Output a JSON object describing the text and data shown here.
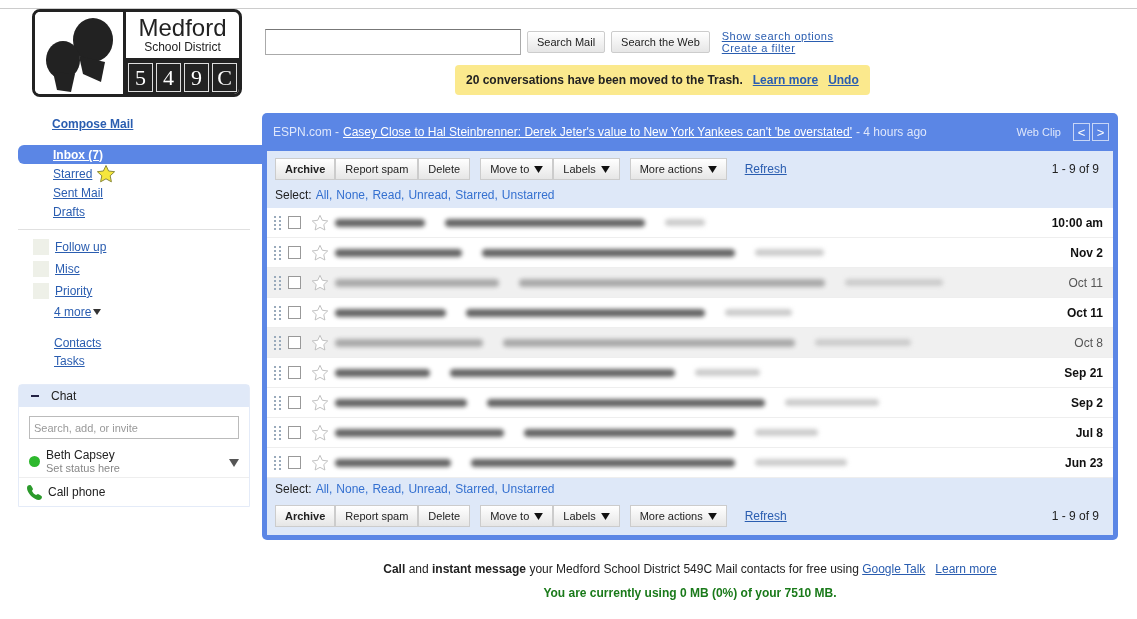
{
  "logo": {
    "name": "Medford",
    "subtitle": "School District",
    "code": [
      "5",
      "4",
      "9",
      "C"
    ]
  },
  "search": {
    "buttons": [
      "Search Mail",
      "Search the Web"
    ],
    "links": [
      "Show search options",
      "Create a filter"
    ]
  },
  "notice": {
    "message": "20 conversations have been moved to the Trash.",
    "links": [
      "Learn more",
      "Undo"
    ]
  },
  "sidebar": {
    "compose": "Compose Mail",
    "folders": [
      {
        "label": "Inbox (7)",
        "selected": true,
        "kind": "plain"
      },
      {
        "label": "Starred",
        "selected": false,
        "kind": "starred"
      },
      {
        "label": "Sent Mail",
        "selected": false,
        "kind": "plain"
      },
      {
        "label": "Drafts",
        "selected": false,
        "kind": "plain"
      }
    ],
    "labels": [
      "Follow up",
      "Misc",
      "Priority"
    ],
    "more_labels": "4 more",
    "links": [
      "Contacts",
      "Tasks"
    ]
  },
  "chat": {
    "title": "Chat",
    "expanded": true,
    "placeholder": "Search, add, or invite",
    "user": {
      "name": "Beth Capsey",
      "status": "Set status here",
      "online": true
    },
    "call": "Call phone"
  },
  "web_clip": {
    "source": "ESPN.com -",
    "headline": "Casey Close to Hal Steinbrenner: Derek Jeter's value to New York Yankees can't 'be overstated'",
    "age": "- 4 hours ago",
    "label": "Web Clip",
    "prev": "<",
    "next": ">"
  },
  "top_toolbar": {
    "button_groups": [
      [
        {
          "label": "Archive",
          "kind": "bold"
        },
        {
          "label": "Report spam",
          "kind": "plain"
        },
        {
          "label": "Delete",
          "kind": "plain"
        }
      ],
      [
        {
          "label": "Move to",
          "kind": "menu"
        },
        {
          "label": "Labels",
          "kind": "menu"
        }
      ],
      [
        {
          "label": "More actions",
          "kind": "menu"
        }
      ]
    ],
    "refresh": "Refresh",
    "count": "1 - 9 of 9"
  },
  "top_select": {
    "label": "Select:",
    "links": [
      "All,",
      "None,",
      "Read,",
      "Unread,",
      "Starred,",
      "Unstarred"
    ]
  },
  "rows": [
    {
      "date": "10:00 am",
      "unread": true,
      "checked": false,
      "starred": false
    },
    {
      "date": "Nov 2",
      "unread": true,
      "checked": false,
      "starred": false
    },
    {
      "date": "Oct 11",
      "unread": false,
      "checked": false,
      "starred": false
    },
    {
      "date": "Oct 11",
      "unread": true,
      "checked": false,
      "starred": false
    },
    {
      "date": "Oct 8",
      "unread": false,
      "checked": false,
      "starred": false
    },
    {
      "date": "Sep 21",
      "unread": true,
      "checked": false,
      "starred": false
    },
    {
      "date": "Sep 2",
      "unread": true,
      "checked": false,
      "starred": false
    },
    {
      "date": "Jul 8",
      "unread": true,
      "checked": false,
      "starred": false
    },
    {
      "date": "Jun 23",
      "unread": true,
      "checked": false,
      "starred": false
    }
  ],
  "bottom_select": {
    "label": "Select:",
    "links": [
      "All,",
      "None,",
      "Read,",
      "Unread,",
      "Starred,",
      "Unstarred"
    ]
  },
  "bottom_toolbar": {
    "button_groups": [
      [
        {
          "label": "Archive",
          "kind": "bold"
        },
        {
          "label": "Report spam",
          "kind": "plain"
        },
        {
          "label": "Delete",
          "kind": "plain"
        }
      ],
      [
        {
          "label": "Move to",
          "kind": "menu"
        },
        {
          "label": "Labels",
          "kind": "menu"
        }
      ],
      [
        {
          "label": "More actions",
          "kind": "menu"
        }
      ]
    ],
    "refresh": "Refresh",
    "count": "1 - 9 of 9"
  },
  "footer": {
    "message": "**Call** and **instant message** your Medford School District 549C Mail contacts for free using",
    "message_link": "Google Talk",
    "link": "Learn more",
    "usage": "You are currently using 0 MB (0%) of your 7510 MB."
  }
}
